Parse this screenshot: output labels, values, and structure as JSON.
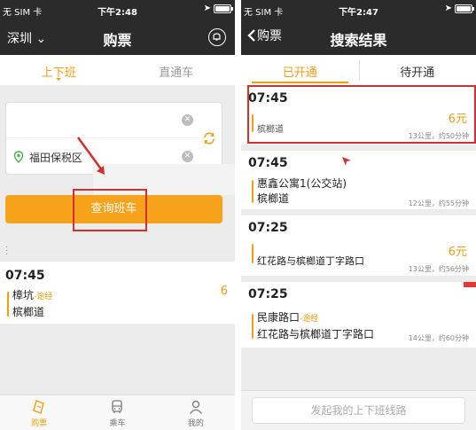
{
  "left": {
    "status": {
      "carrier": "无 SIM 卡",
      "time": "下午2:48"
    },
    "nav": {
      "city": "深圳",
      "title": "购票"
    },
    "tabs": [
      {
        "label": "上下班"
      },
      {
        "label": "直通车"
      }
    ],
    "form": {
      "destination": "福田保税区"
    },
    "query_button": "查询班车",
    "card": {
      "time": "07:45",
      "from": "樟坑",
      "via": "-途经",
      "to": "槟榔道",
      "price_partial": "6"
    },
    "bottom_nav": [
      {
        "label": "购票"
      },
      {
        "label": "乘车"
      },
      {
        "label": "我的"
      }
    ]
  },
  "right": {
    "status": {
      "carrier": "无 SIM 卡",
      "time": "下午2:47"
    },
    "nav": {
      "back": "购票",
      "title": "搜索结果"
    },
    "tabs": [
      {
        "label": "已开通"
      },
      {
        "label": "待开通"
      }
    ],
    "results": [
      {
        "time": "07:45",
        "stop_partial": "槟榔道",
        "price": "6元",
        "meta": "13公里，约50分钟"
      },
      {
        "time": "07:45",
        "from": "惠鑫公寓1(公交站)",
        "to": "槟榔道",
        "meta": "12公里，约55分钟"
      },
      {
        "time": "07:25",
        "stop_partial": "红花路与槟榔道丁字路口",
        "price": "6元",
        "meta": "13公里，约56分钟"
      },
      {
        "time": "07:25",
        "from": "民康路口",
        "via": "-途经",
        "to": "红花路与槟榔道丁字路口",
        "meta": "14公里，约60分钟"
      }
    ],
    "plan_button": "发起我的上下班线路"
  },
  "colors": {
    "accent": "#f39c12",
    "button": "#f6a21a",
    "annotation": "#d32f2f",
    "bar": "#2b2b2b"
  }
}
